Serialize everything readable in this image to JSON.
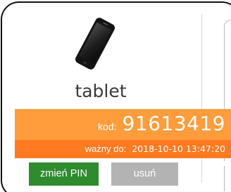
{
  "device": {
    "icon": "smartphone-icon",
    "name": "tablet"
  },
  "code": {
    "label": "kod:",
    "value": "91613419"
  },
  "validity": {
    "label": "ważny do:",
    "value": "2018-10-10 13:47:20"
  },
  "actions": {
    "change_pin": "zmień PIN",
    "delete": "usuń"
  },
  "colors": {
    "code_background": "#ff9c3b",
    "validity_background": "#ff7a20",
    "change_pin_button": "#2e8b2e",
    "delete_button": "#b3b3b3"
  }
}
